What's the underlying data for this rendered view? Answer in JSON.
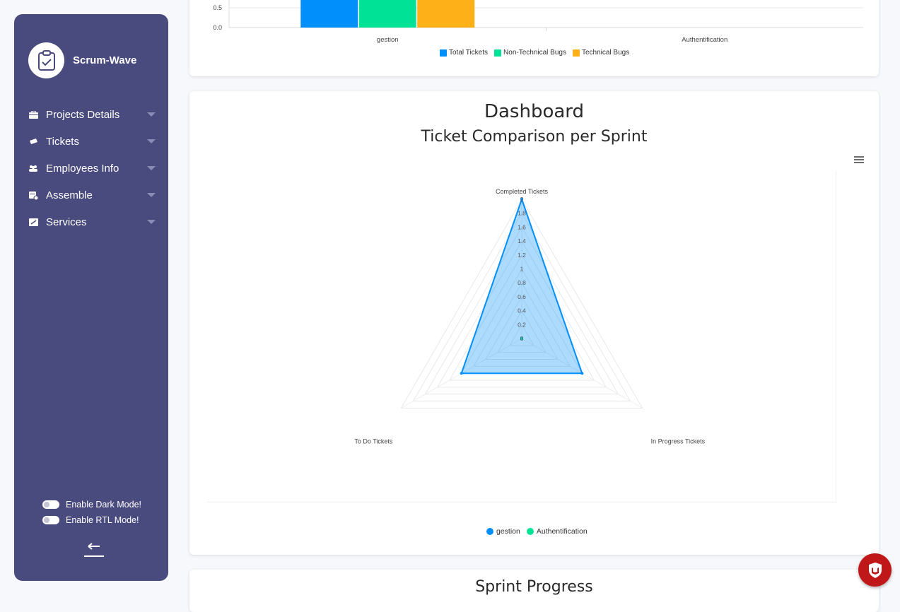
{
  "sidebar": {
    "brand": "Scrum-Wave",
    "items": [
      {
        "label": "Projects Details",
        "icon": "briefcase-icon"
      },
      {
        "label": "Tickets",
        "icon": "ticket-icon"
      },
      {
        "label": "Employees Info",
        "icon": "users-icon"
      },
      {
        "label": "Assemble",
        "icon": "calendar-icon"
      },
      {
        "label": "Services",
        "icon": "services-icon"
      }
    ],
    "dark_mode_label": "Enable Dark Mode!",
    "rtl_mode_label": "Enable RTL Mode!"
  },
  "main": {
    "dashboard_title": "Dashboard",
    "dashboard_subtitle": "Ticket Comparison per Sprint",
    "sprint_progress_title": "Sprint Progress"
  },
  "colors": {
    "sidebar": "#494a7e",
    "blue": "#008ffb",
    "green": "#00e396",
    "orange": "#feb019"
  },
  "chart_data": [
    {
      "type": "bar",
      "categories": [
        "gestion",
        "Authentification"
      ],
      "series": [
        {
          "name": "Total Tickets",
          "values": [
            3,
            0
          ]
        },
        {
          "name": "Non-Technical Bugs",
          "values": [
            3,
            0
          ]
        },
        {
          "name": "Technical Bugs",
          "values": [
            3,
            0
          ]
        }
      ],
      "y_ticks_visible": [
        "0.0",
        "0.5"
      ],
      "legend": "bottom"
    },
    {
      "type": "radar",
      "axes": [
        "Completed Tickets",
        "In Progress Tickets",
        "To Do Tickets"
      ],
      "r_ticks": [
        "0",
        "0.2",
        "0.4",
        "0.6",
        "0.8",
        "1",
        "1.2",
        "1.4",
        "1.6",
        "1.8",
        "2"
      ],
      "rmax": 2,
      "series": [
        {
          "name": "gestion",
          "values": [
            2,
            1,
            1
          ]
        },
        {
          "name": "Authentification",
          "values": [
            0,
            0,
            0
          ]
        }
      ],
      "legend": "bottom"
    }
  ]
}
